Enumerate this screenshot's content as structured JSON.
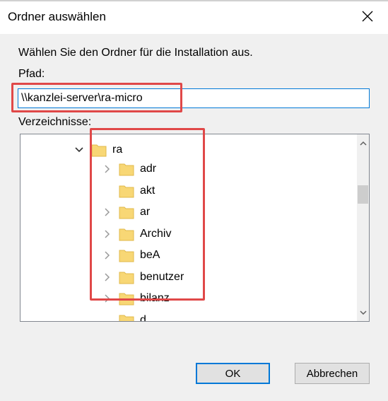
{
  "dialog": {
    "title": "Ordner auswählen",
    "instruction": "Wählen Sie den Ordner für die Installation aus.",
    "path_label": "Pfad:",
    "path_value": "\\\\kanzlei-server\\ra-micro",
    "dirs_label": "Verzeichnisse:",
    "ok_label": "OK",
    "cancel_label": "Abbrechen"
  },
  "tree": {
    "root": {
      "label": "ra",
      "expanded": true
    },
    "items": [
      {
        "label": "adr",
        "has_children": true
      },
      {
        "label": "akt",
        "has_children": false
      },
      {
        "label": "ar",
        "has_children": true
      },
      {
        "label": "Archiv",
        "has_children": true
      },
      {
        "label": "beA",
        "has_children": true
      },
      {
        "label": "benutzer",
        "has_children": true
      },
      {
        "label": "bilanz",
        "has_children": true
      },
      {
        "label": "d",
        "has_children": false
      }
    ]
  },
  "colors": {
    "accent": "#0078d7",
    "highlight": "#e04848",
    "folder": "#f8d775",
    "folder_dark": "#e0b84a"
  }
}
